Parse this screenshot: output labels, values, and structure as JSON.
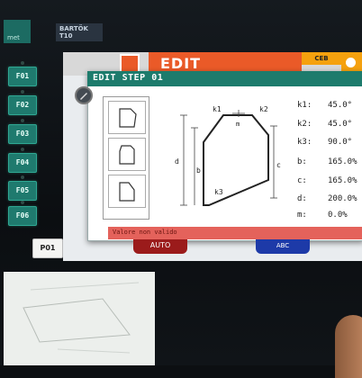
{
  "device": {
    "logo_text": "met",
    "model_label": "BARTÖK\nT10"
  },
  "side_buttons": [
    "F01",
    "F02",
    "F03",
    "F04",
    "F05",
    "F06"
  ],
  "program_button": "P01",
  "screen": {
    "header_title": "EDIT",
    "header_badge": "CEB"
  },
  "dialog": {
    "title": "EDIT STEP 01",
    "drawing_labels": {
      "k1": "k1",
      "k2": "k2",
      "k3": "k3",
      "m": "m",
      "b": "b",
      "c": "c",
      "d": "d"
    },
    "values": [
      {
        "label": "k1:",
        "value": "45.0°"
      },
      {
        "label": "k2:",
        "value": "45.0°"
      },
      {
        "label": "k3:",
        "value": "90.0°"
      },
      {
        "label": "b:",
        "value": "165.0%"
      },
      {
        "label": "c:",
        "value": "165.0%"
      },
      {
        "label": "d:",
        "value": "200.0%"
      },
      {
        "label": "m:",
        "value": "0.0%"
      }
    ],
    "error_message": "Valore non valido"
  },
  "bottom_buttons": {
    "auto": "AUTO",
    "abc": "ABC"
  },
  "colors": {
    "teal": "#1d7b6c",
    "edit_orange": "#ea5a28",
    "badge_yellow": "#f5a10e",
    "error_red": "#e4625b",
    "side_button_green": "#1f7a6e"
  }
}
